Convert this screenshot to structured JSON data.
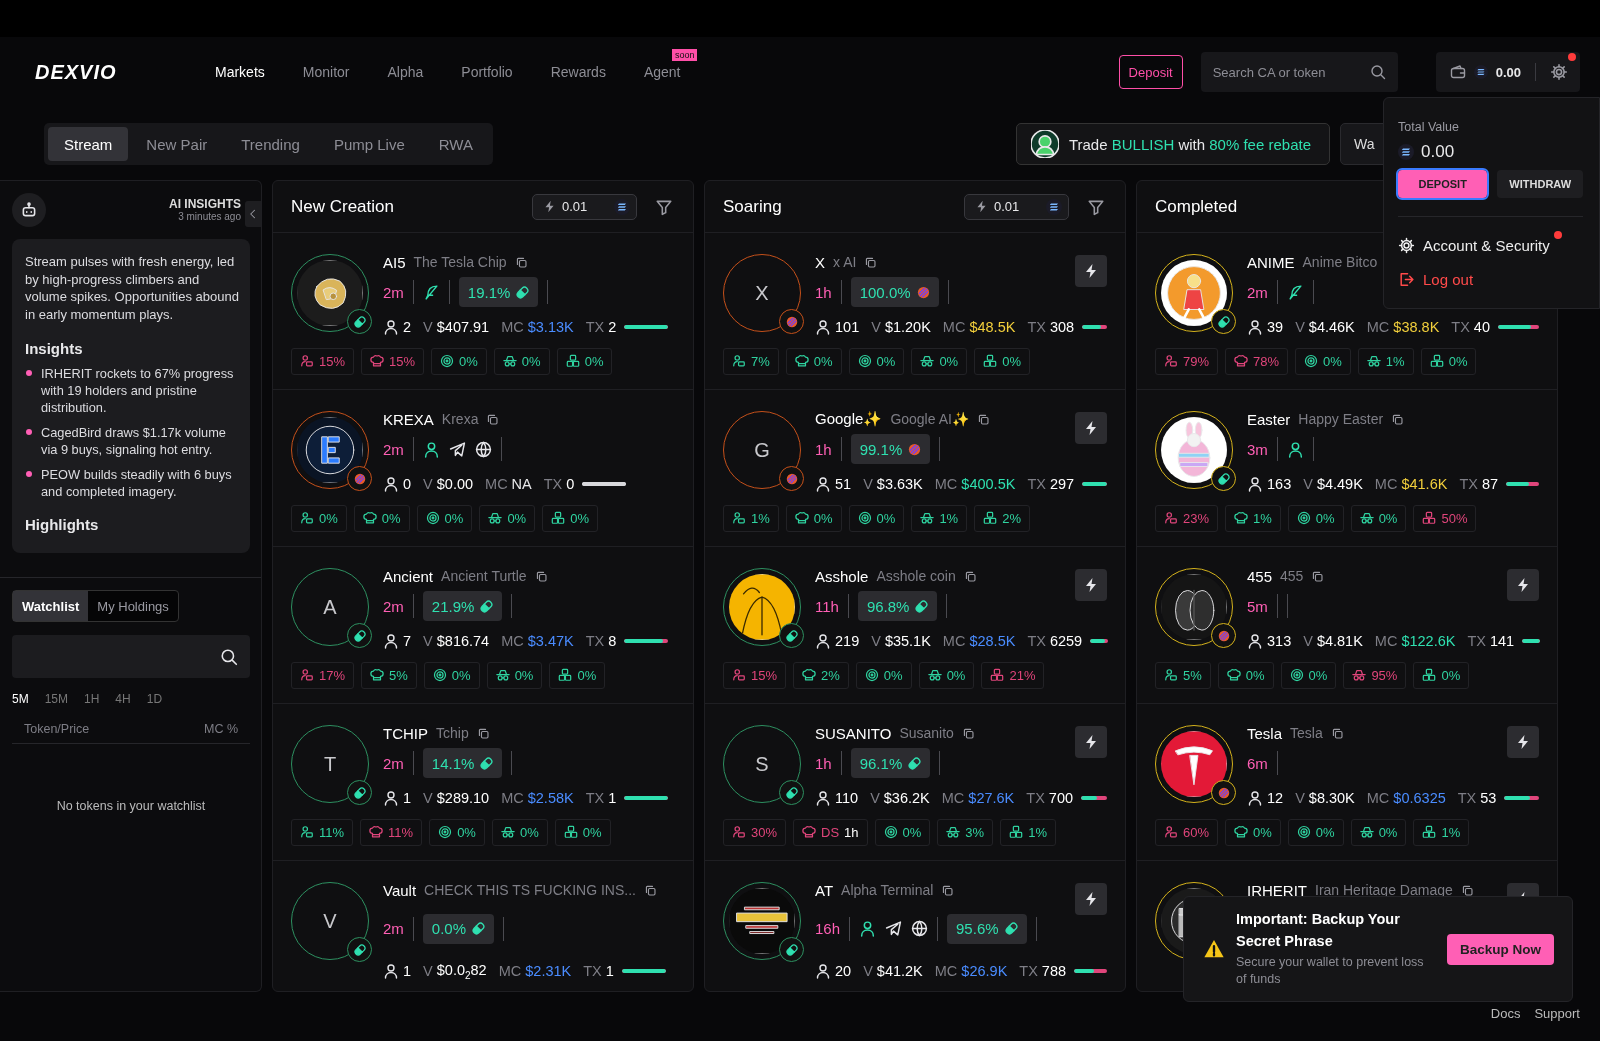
{
  "header": {
    "logo": "DEXVIO",
    "nav": [
      {
        "label": "Markets",
        "selected": true
      },
      {
        "label": "Monitor",
        "selected": false
      },
      {
        "label": "Alpha",
        "selected": false
      },
      {
        "label": "Portfolio",
        "selected": false
      },
      {
        "label": "Rewards",
        "selected": false
      },
      {
        "label": "Agent",
        "selected": false,
        "badge": "soon"
      }
    ],
    "deposit_button": "Deposit",
    "search": {
      "placeholder": "Search CA or token"
    },
    "wallet": {
      "balance": "0.00",
      "notification": true
    }
  },
  "stream_tabs": [
    {
      "label": "Stream",
      "selected": true
    },
    {
      "label": "New Pair",
      "selected": false
    },
    {
      "label": "Trending",
      "selected": false
    },
    {
      "label": "Pump Live",
      "selected": false
    },
    {
      "label": "RWA",
      "selected": false
    }
  ],
  "promo": {
    "parts": [
      {
        "text": "Trade ",
        "highlight": false
      },
      {
        "text": "BULLISH",
        "highlight": true
      },
      {
        "text": " with ",
        "highlight": false
      },
      {
        "text": "80% fee rebate",
        "highlight": true
      }
    ]
  },
  "wallet_button": "Wa",
  "sidebar": {
    "insights": {
      "title": "AI INSIGHTS",
      "time": "3 minutes ago",
      "summary": "Stream pulses with fresh energy, led by high-progress climbers and volume spikes. Opportunities abound in early momentum plays.",
      "sections": [
        {
          "heading": "Insights",
          "bullets": [
            "IRHERIT rockets to 67% progress with 19 holders and pristine distribution.",
            "CagedBird draws $1.17k volume via 9 buys, signaling hot entry.",
            "PEOW builds steadily with 6 buys and completed imagery."
          ]
        },
        {
          "heading": "Highlights"
        }
      ]
    },
    "tabs": [
      {
        "label": "Watchlist",
        "selected": true
      },
      {
        "label": "My Holdings",
        "selected": false
      }
    ],
    "timeframes": [
      {
        "label": "5M",
        "selected": true
      },
      {
        "label": "15M",
        "selected": false
      },
      {
        "label": "1H",
        "selected": false
      },
      {
        "label": "4H",
        "selected": false
      },
      {
        "label": "1D",
        "selected": false
      }
    ],
    "table": {
      "columns": [
        "Token/Price",
        "MC %"
      ],
      "empty": "No tokens in your watchlist"
    }
  },
  "columns": [
    {
      "title": "New Creation",
      "amount": "0.01",
      "tokens": [
        {
          "symbol": "AI5",
          "name": "The Tesla Chip",
          "avatar": {
            "kind": "picture"
          },
          "color": "#2d8f60",
          "badge": {
            "kind": "pill"
          },
          "flash": false,
          "age": "2m",
          "groups": [
            {
              "kind": "links",
              "items": [
                {
                  "kind": "launchpad"
                }
              ]
            },
            {
              "kind": "progress",
              "value": "19.1%"
            }
          ],
          "holders": "2",
          "volume": {
            "label": "V",
            "value": "$407.91"
          },
          "mc": {
            "label": "MC",
            "value": "$3.13K",
            "color": "#4a8cff"
          },
          "tx": {
            "label": "TX",
            "value": "2",
            "level": 1,
            "active": true
          },
          "stats": [
            {
              "kind": "holders",
              "value": "15%",
              "alert": true
            },
            {
              "kind": "dev",
              "value": "15%",
              "alert": true
            },
            {
              "kind": "snipers",
              "value": "0%",
              "alert": false
            },
            {
              "kind": "insiders",
              "value": "0%",
              "alert": false
            },
            {
              "kind": "bundlers",
              "value": "0%",
              "alert": false
            }
          ]
        },
        {
          "symbol": "KREXA",
          "name": "Krexa",
          "avatar": {
            "kind": "picture"
          },
          "color": "#c4501a",
          "badge": {
            "kind": "striped"
          },
          "flash": false,
          "age": "2m",
          "groups": [
            {
              "kind": "links",
              "items": [
                {
                  "kind": "profile"
                },
                {
                  "kind": "telegram"
                },
                {
                  "kind": "website"
                }
              ]
            }
          ],
          "holders": "0",
          "volume": {
            "label": "V",
            "value": "$0.00"
          },
          "mc": {
            "label": "MC",
            "value": "NA",
            "color": "#e8e8ea"
          },
          "tx": {
            "label": "TX",
            "value": "0",
            "level": 1,
            "active": false
          },
          "stats": [
            {
              "kind": "holders",
              "value": "0%",
              "alert": false
            },
            {
              "kind": "dev",
              "value": "0%",
              "alert": false
            },
            {
              "kind": "snipers",
              "value": "0%",
              "alert": false
            },
            {
              "kind": "insiders",
              "value": "0%",
              "alert": false
            },
            {
              "kind": "bundlers",
              "value": "0%",
              "alert": false
            }
          ]
        },
        {
          "symbol": "Ancient",
          "name": "Ancient Turtle",
          "avatar": {
            "kind": "letter",
            "letter": "A"
          },
          "color": "#2d8f60",
          "badge": {
            "kind": "pill"
          },
          "flash": false,
          "age": "2m",
          "groups": [
            {
              "kind": "progress",
              "value": "21.9%"
            }
          ],
          "holders": "7",
          "volume": {
            "label": "V",
            "value": "$816.74"
          },
          "mc": {
            "label": "MC",
            "value": "$3.47K",
            "color": "#4a8cff"
          },
          "tx": {
            "label": "TX",
            "value": "8",
            "level": 0.88,
            "active": true
          },
          "stats": [
            {
              "kind": "holders",
              "value": "17%",
              "alert": true
            },
            {
              "kind": "dev",
              "value": "5%",
              "alert": false
            },
            {
              "kind": "snipers",
              "value": "0%",
              "alert": false
            },
            {
              "kind": "insiders",
              "value": "0%",
              "alert": false
            },
            {
              "kind": "bundlers",
              "value": "0%",
              "alert": false
            }
          ]
        },
        {
          "symbol": "TCHIP",
          "name": "Tchip",
          "avatar": {
            "kind": "letter",
            "letter": "T"
          },
          "color": "#2d8f60",
          "badge": {
            "kind": "pill"
          },
          "flash": false,
          "age": "2m",
          "groups": [
            {
              "kind": "progress",
              "value": "14.1%"
            }
          ],
          "holders": "1",
          "volume": {
            "label": "V",
            "value": "$289.10"
          },
          "mc": {
            "label": "MC",
            "value": "$2.58K",
            "color": "#4a8cff"
          },
          "tx": {
            "label": "TX",
            "value": "1",
            "level": 1,
            "active": true
          },
          "stats": [
            {
              "kind": "holders",
              "value": "11%",
              "alert": false
            },
            {
              "kind": "dev",
              "value": "11%",
              "alert": true
            },
            {
              "kind": "snipers",
              "value": "0%",
              "alert": false
            },
            {
              "kind": "insiders",
              "value": "0%",
              "alert": false
            },
            {
              "kind": "bundlers",
              "value": "0%",
              "alert": false
            }
          ]
        },
        {
          "symbol": "Vault",
          "name": "CHECK THIS TS FUCKING INS...",
          "avatar": {
            "kind": "letter",
            "letter": "V"
          },
          "color": "#2d8f60",
          "badge": {
            "kind": "pill"
          },
          "flash": false,
          "age": "2m",
          "groups": [
            {
              "kind": "progress",
              "value": "0.0%"
            }
          ],
          "holders": "1",
          "volume": {
            "label": "V",
            "value": "$0.0$_{2}$82"
          },
          "mc": {
            "label": "MC",
            "value": "$2.31K",
            "color": "#4a8cff"
          },
          "tx": {
            "label": "TX",
            "value": "1",
            "level": 1,
            "active": true
          }
        }
      ]
    },
    {
      "title": "Soaring",
      "amount": "0.01",
      "tokens": [
        {
          "symbol": "X",
          "name": "x AI",
          "avatar": {
            "kind": "letter",
            "letter": "X"
          },
          "color": "#c4501a",
          "badge": {
            "kind": "striped"
          },
          "flash": true,
          "age": "1h",
          "groups": [
            {
              "kind": "progress",
              "value": "100.0%"
            }
          ],
          "holders": "101",
          "volume": {
            "label": "V",
            "value": "$1.20K"
          },
          "mc": {
            "label": "MC",
            "value": "$48.5K",
            "color": "#f2cf3c"
          },
          "tx": {
            "label": "TX",
            "value": "308",
            "level": 0.75,
            "active": true
          },
          "stats": [
            {
              "kind": "holders",
              "value": "7%",
              "alert": false
            },
            {
              "kind": "dev",
              "value": "0%",
              "alert": false
            },
            {
              "kind": "snipers",
              "value": "0%",
              "alert": false
            },
            {
              "kind": "insiders",
              "value": "0%",
              "alert": false
            },
            {
              "kind": "bundlers",
              "value": "0%",
              "alert": false
            }
          ]
        },
        {
          "symbol": "Google✨",
          "name": "Google AI✨",
          "avatar": {
            "kind": "letter",
            "letter": "G"
          },
          "color": "#c4501a",
          "badge": {
            "kind": "striped"
          },
          "flash": true,
          "age": "1h",
          "groups": [
            {
              "kind": "progress",
              "value": "99.1%"
            }
          ],
          "holders": "51",
          "volume": {
            "label": "V",
            "value": "$3.63K"
          },
          "mc": {
            "label": "MC",
            "value": "$400.5K",
            "color": "#2fe0b0"
          },
          "tx": {
            "label": "TX",
            "value": "297",
            "level": 1,
            "active": true
          },
          "stats": [
            {
              "kind": "holders",
              "value": "1%",
              "alert": false
            },
            {
              "kind": "dev",
              "value": "0%",
              "alert": false
            },
            {
              "kind": "snipers",
              "value": "0%",
              "alert": false
            },
            {
              "kind": "insiders",
              "value": "1%",
              "alert": false
            },
            {
              "kind": "bundlers",
              "value": "2%",
              "alert": false
            }
          ]
        },
        {
          "symbol": "Asshole",
          "name": "Asshole coin",
          "avatar": {
            "kind": "picture"
          },
          "color": "#2d8f60",
          "badge": {
            "kind": "pill"
          },
          "flash": true,
          "age": "11h",
          "groups": [
            {
              "kind": "progress",
              "value": "96.8%"
            }
          ],
          "holders": "219",
          "volume": {
            "label": "V",
            "value": "$35.1K"
          },
          "mc": {
            "label": "MC",
            "value": "$28.5K",
            "color": "#4a8cff"
          },
          "tx": {
            "label": "TX",
            "value": "6259",
            "level": 0.8,
            "active": true
          },
          "stats": [
            {
              "kind": "holders",
              "value": "15%",
              "alert": true
            },
            {
              "kind": "dev",
              "value": "2%",
              "alert": false
            },
            {
              "kind": "snipers",
              "value": "0%",
              "alert": false
            },
            {
              "kind": "insiders",
              "value": "0%",
              "alert": false
            },
            {
              "kind": "bundlers",
              "value": "21%",
              "alert": true
            }
          ]
        },
        {
          "symbol": "SUSANITO",
          "name": "Susanito",
          "avatar": {
            "kind": "letter",
            "letter": "S"
          },
          "color": "#2d8f60",
          "badge": {
            "kind": "pill"
          },
          "flash": true,
          "age": "1h",
          "groups": [
            {
              "kind": "progress",
              "value": "96.1%"
            }
          ],
          "holders": "110",
          "volume": {
            "label": "V",
            "value": "$36.2K"
          },
          "mc": {
            "label": "MC",
            "value": "$27.6K",
            "color": "#4a8cff"
          },
          "tx": {
            "label": "TX",
            "value": "700",
            "level": 0.6,
            "active": true
          },
          "stats": [
            {
              "kind": "holders",
              "value": "30%",
              "alert": true
            },
            {
              "kind": "dev",
              "value": "DS",
              "extra": "1h",
              "alert": true
            },
            {
              "kind": "snipers",
              "value": "0%",
              "alert": false
            },
            {
              "kind": "insiders",
              "value": "3%",
              "alert": false
            },
            {
              "kind": "bundlers",
              "value": "1%",
              "alert": false
            }
          ]
        },
        {
          "symbol": "AT",
          "name": "Alpha Terminal",
          "avatar": {
            "kind": "picture"
          },
          "color": "#2d8f60",
          "badge": {
            "kind": "pill"
          },
          "flash": true,
          "age": "16h",
          "groups": [
            {
              "kind": "links",
              "items": [
                {
                  "kind": "profile"
                },
                {
                  "kind": "telegram"
                },
                {
                  "kind": "website"
                }
              ]
            },
            {
              "kind": "progress",
              "value": "95.6%"
            }
          ],
          "holders": "20",
          "volume": {
            "label": "V",
            "value": "$41.2K"
          },
          "mc": {
            "label": "MC",
            "value": "$26.9K",
            "color": "#4a8cff"
          },
          "tx": {
            "label": "TX",
            "value": "788",
            "level": 0.6,
            "active": true
          }
        }
      ]
    },
    {
      "title": "Completed",
      "tokens": [
        {
          "symbol": "ANIME",
          "name": "Anime Bitco",
          "copy": false,
          "avatar": {
            "kind": "picture"
          },
          "color": "#d4b21c",
          "badge": {
            "kind": "pill"
          },
          "flash": false,
          "age": "2m",
          "groups": [
            {
              "kind": "links",
              "items": [
                {
                  "kind": "launchpad"
                }
              ]
            }
          ],
          "holders": "39",
          "volume": {
            "label": "V",
            "value": "$4.46K"
          },
          "mc": {
            "label": "MC",
            "value": "$38.8K",
            "color": "#f2cf3c"
          },
          "tx": {
            "label": "TX",
            "value": "40",
            "level": 0.8,
            "active": true
          },
          "stats": [
            {
              "kind": "holders",
              "value": "79%",
              "alert": true
            },
            {
              "kind": "dev",
              "value": "78%",
              "alert": true
            },
            {
              "kind": "snipers",
              "value": "0%",
              "alert": false
            },
            {
              "kind": "insiders",
              "value": "1%",
              "alert": false
            },
            {
              "kind": "bundlers",
              "value": "0%",
              "alert": false
            }
          ]
        },
        {
          "symbol": "Easter",
          "name": "Happy Easter",
          "avatar": {
            "kind": "picture"
          },
          "color": "#d4b21c",
          "badge": {
            "kind": "pill"
          },
          "flash": false,
          "age": "3m",
          "groups": [
            {
              "kind": "links",
              "items": [
                {
                  "kind": "profile"
                }
              ]
            }
          ],
          "holders": "163",
          "volume": {
            "label": "V",
            "value": "$4.49K"
          },
          "mc": {
            "label": "MC",
            "value": "$41.6K",
            "color": "#f2cf3c"
          },
          "tx": {
            "label": "TX",
            "value": "87",
            "level": 0.7,
            "active": true
          },
          "stats": [
            {
              "kind": "holders",
              "value": "23%",
              "alert": true
            },
            {
              "kind": "dev",
              "value": "1%",
              "alert": false
            },
            {
              "kind": "snipers",
              "value": "0%",
              "alert": false
            },
            {
              "kind": "insiders",
              "value": "0%",
              "alert": false
            },
            {
              "kind": "bundlers",
              "value": "50%",
              "alert": true
            }
          ]
        },
        {
          "symbol": "455",
          "name": "455",
          "avatar": {
            "kind": "picture"
          },
          "color": "#d4b21c",
          "badge": {
            "kind": "striped"
          },
          "flash": true,
          "age": "5m",
          "groups": [
            {
              "kind": "spacer"
            }
          ],
          "holders": "313",
          "volume": {
            "label": "V",
            "value": "$4.81K"
          },
          "mc": {
            "label": "MC",
            "value": "$122.6K",
            "color": "#2fe0b0"
          },
          "tx": {
            "label": "TX",
            "value": "141",
            "level": 1,
            "active": true
          },
          "stats": [
            {
              "kind": "holders",
              "value": "5%",
              "alert": false
            },
            {
              "kind": "dev",
              "value": "0%",
              "alert": false
            },
            {
              "kind": "snipers",
              "value": "0%",
              "alert": false
            },
            {
              "kind": "insiders",
              "value": "95%",
              "alert": true
            },
            {
              "kind": "bundlers",
              "value": "0%",
              "alert": false
            }
          ]
        },
        {
          "symbol": "Tesla",
          "name": "Tesla",
          "avatar": {
            "kind": "picture"
          },
          "color": "#d4b21c",
          "badge": {
            "kind": "striped"
          },
          "flash": true,
          "age": "6m",
          "holders": "12",
          "volume": {
            "label": "V",
            "value": "$8.30K"
          },
          "mc": {
            "label": "MC",
            "value": "$0.6325",
            "color": "#4a8cff"
          },
          "tx": {
            "label": "TX",
            "value": "53",
            "level": 0.75,
            "active": true
          },
          "stats": [
            {
              "kind": "holders",
              "value": "60%",
              "alert": true
            },
            {
              "kind": "dev",
              "value": "0%",
              "alert": false
            },
            {
              "kind": "snipers",
              "value": "0%",
              "alert": false
            },
            {
              "kind": "insiders",
              "value": "0%",
              "alert": false
            },
            {
              "kind": "bundlers",
              "value": "1%",
              "alert": false
            }
          ]
        },
        {
          "symbol": "IRHERIT",
          "name": "Iran Heritage Damage",
          "avatar": {
            "kind": "picture"
          },
          "color": "#d4b21c",
          "flash": true
        }
      ]
    }
  ],
  "wallet_menu": {
    "label": "Total Value",
    "value": "0.00",
    "buttons": [
      {
        "label": "DEPOSIT",
        "kind": "primary"
      },
      {
        "label": "WITHDRAW",
        "kind": "secondary"
      }
    ],
    "items": [
      {
        "label": "Account & Security",
        "kind": "settings",
        "notification": true
      },
      {
        "label": "Log out",
        "kind": "logout",
        "notification": false
      }
    ]
  },
  "toast": {
    "title": "Important: Backup Your Secret Phrase",
    "message": "Secure your wallet to prevent loss of funds",
    "button": "Backup Now"
  },
  "footer": [
    "Docs",
    "Support"
  ]
}
